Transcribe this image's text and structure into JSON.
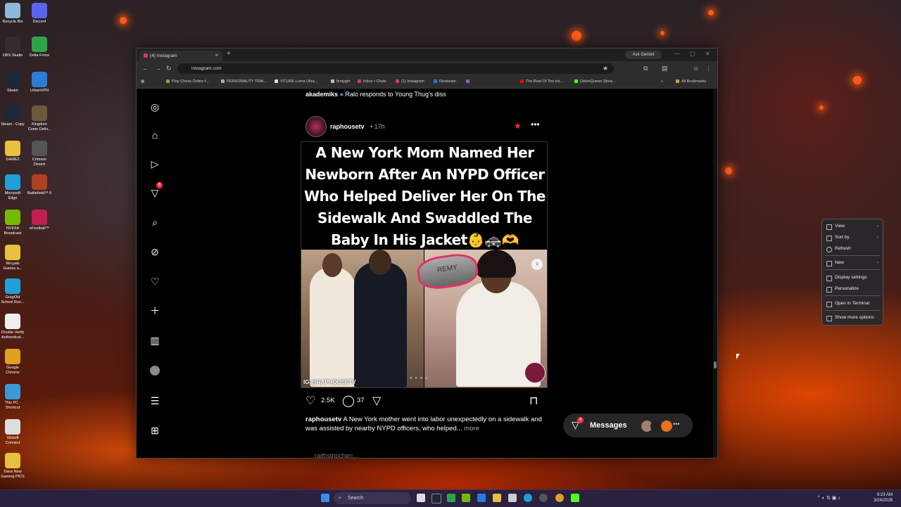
{
  "desktop": {
    "icons": [
      {
        "label": "Recycle Bin",
        "color": "#8fb8d8"
      },
      {
        "label": "Discord",
        "color": "#5865f2"
      },
      {
        "label": "OBS Studio",
        "color": "#302e31"
      },
      {
        "label": "Delta Force",
        "color": "#2fa34a"
      },
      {
        "label": "Steam",
        "color": "#1b2838"
      },
      {
        "label": "UrbanVPN",
        "color": "#2b7bd8"
      },
      {
        "label": "Steam - Copy",
        "color": "#1b2838"
      },
      {
        "label": "Kingdom Come Deliv...",
        "color": "#6b5a3a"
      },
      {
        "label": "GAMEZ",
        "color": "#e8c040"
      },
      {
        "label": "Crimson Desert",
        "color": "#555"
      },
      {
        "label": "Microsoft Edge",
        "color": "#1fa0d8"
      },
      {
        "label": "Battlefield™ 6",
        "color": "#b04020"
      },
      {
        "label": "NVIDIA Broadcast",
        "color": "#76b900"
      },
      {
        "label": "eFootball™",
        "color": "#c02050"
      },
      {
        "label": "Wrcyals Games a...",
        "color": "#e8c040"
      },
      {
        "label": "GregOld School Run...",
        "color": "#1fa0d8"
      },
      {
        "label": "Double Verify Authenticat...",
        "color": "#eee"
      },
      {
        "label": "Google Chrome",
        "color": "#e0a020"
      },
      {
        "label": "This PC - Shortcut",
        "color": "#3a9ad8"
      },
      {
        "label": "Ubisoft Connect",
        "color": "#ddd"
      },
      {
        "label": "Dans New Gaming PICS",
        "color": "#e8c040"
      }
    ]
  },
  "browser": {
    "tab_title": "(4) Instagram",
    "ask_gemini": "Ask Gemini",
    "url": "instagram.com",
    "bookmarks": [
      "Play Chess Online f...",
      "PERSONALITY TRAI...",
      "VITURE Luma Ultra...",
      "fentygirl",
      "Inbox • Chats",
      "(1) Instagram",
      "Restream",
      "",
      "The Best Of The Int...",
      "DeIenQueen Strea..."
    ],
    "all_bookmarks": "All Bookmarks"
  },
  "instagram": {
    "prev_caption_user": "akademiks",
    "prev_caption_text": "Ralo responds to Young Thug's diss",
    "post": {
      "username": "raphousetv",
      "time": "• 17h",
      "headline": "A New York Mom Named Her Newborn After An NYPD Officer Who Helped Deliver Her On The Sidewalk And Swaddled The Baby In His Jacket👶🚓🫶",
      "watermark": "IG:@RAPHOUSETV",
      "overlay_text": "REMY",
      "likes": "2.5K",
      "comments": "37",
      "caption_user": "raphousetv",
      "caption_text": "A New York mother went into labor unexpectedly on a sidewalk and was assisted by nearby NYPD officers, who helped...",
      "more": "more"
    },
    "next_post_user": "raithstripcheri...",
    "notifications_badge": "6",
    "messages_label": "Messages",
    "messages_badge": "4"
  },
  "context_menu": {
    "items": [
      "View",
      "Sort by",
      "Refresh",
      "New",
      "Display settings",
      "Personalize",
      "Open in Terminal",
      "Show more options"
    ]
  },
  "taskbar": {
    "search": "Search",
    "time": "8:23 AM",
    "date": "3/24/2026"
  }
}
